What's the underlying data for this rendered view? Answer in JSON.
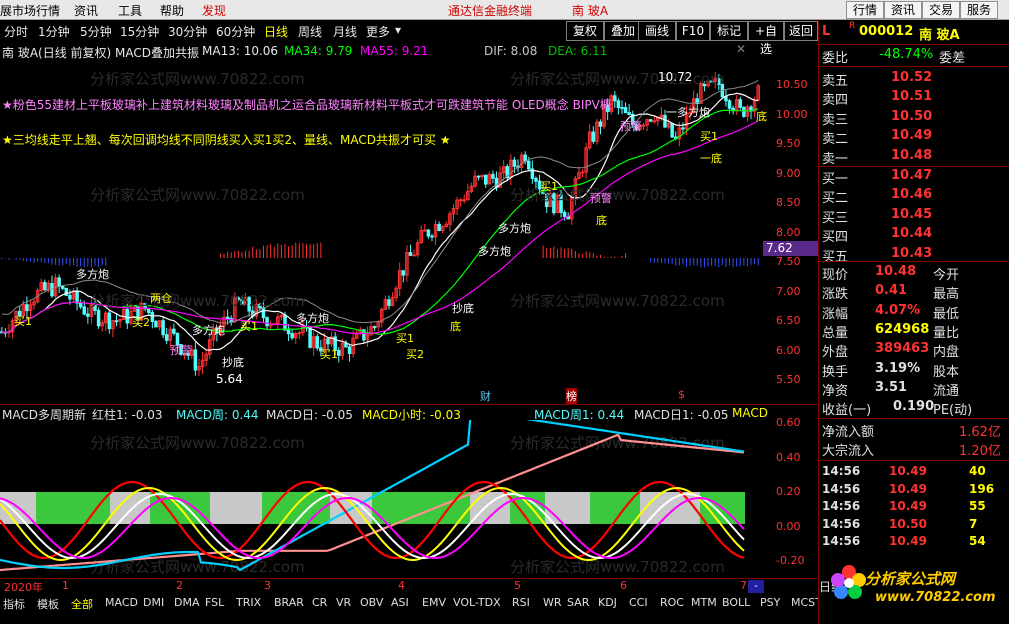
{
  "menubar": {
    "items": [
      "展市场行情",
      "资讯",
      "工具",
      "帮助",
      "发现"
    ],
    "app_title": "通达信金融终端",
    "stock_name": "南 玻A",
    "right_buttons": [
      "行情",
      "资讯",
      "交易",
      "服务"
    ]
  },
  "periodbar": {
    "periods": [
      "分时",
      "1分钟",
      "5分钟",
      "15分钟",
      "30分钟",
      "60分钟",
      "日线",
      "周线",
      "月线",
      "更多"
    ],
    "selected": "日线",
    "tools": [
      "复权",
      "叠加",
      "画线",
      "F10",
      "标记",
      "+自选",
      "返回"
    ]
  },
  "main_info": {
    "title": "南 玻A(日线 前复权) MACD叠加共振",
    "ma13": "MA13: 10.06",
    "ma34": "MA34: 9.79",
    "ma55": "MA55: 9.21",
    "dif": "DIF: 8.08",
    "dea": "DEA: 6.11"
  },
  "concepts": {
    "line1": "★粉色55建材上平板玻璃补上建筑材料玻璃及制品机之运合品玻璃新材料平板式才可跌建筑节能 OLED概念 BIPV概念",
    "line2": "★三均线走平上翘、每次回调均线不同阴线买入买1买2、量线、MACD共振才可买 ★"
  },
  "price_labels": {
    "high": "10.72",
    "low": "5.64",
    "current": "7.62",
    "axis": [
      "10.50",
      "10.00",
      "9.50",
      "9.00",
      "8.50",
      "8.00",
      "7.50",
      "7.00",
      "6.50",
      "6.00",
      "5.50"
    ]
  },
  "chart_annotations": [
    "多方炮",
    "多方炮",
    "买1",
    "买2",
    "两仓",
    "抄底",
    "买1",
    "多方炮",
    "多方炮",
    "买1",
    "买2",
    "抄底",
    "买1",
    "预警",
    "底",
    "买1",
    "预警",
    "底",
    "一多方炮",
    "预警",
    "多方炮",
    "买1",
    "一底",
    "底",
    "财",
    "榜",
    "$"
  ],
  "indicator": {
    "title": "MACD多周期新",
    "red_col": "红柱1: -0.03",
    "macd_week": "MACD周: 0.44",
    "macd_day": "MACD日: -0.05",
    "macd_hour": "MACD小时: -0.03",
    "macd_week1": "MACD周1: 0.44",
    "macd_day1": "MACD日1: -0.05",
    "macd_tail": "MACD",
    "axis": [
      "0.60",
      "0.40",
      "0.20",
      "0.00",
      "-0.20"
    ]
  },
  "timeaxis": [
    "2020年",
    "1",
    "2",
    "3",
    "4",
    "5",
    "6",
    "7"
  ],
  "tabs": [
    "指标",
    "模板",
    "全部",
    "MACD",
    "DMI",
    "DMA",
    "FSL",
    "TRIX",
    "BRAR",
    "CR",
    "VR",
    "OBV",
    "ASI",
    "EMV",
    "VOL-TDX",
    "RSI",
    "WR",
    "SAR",
    "KDJ",
    "CCI",
    "ROC",
    "MTM",
    "BOLL",
    "PSY",
    "MCST"
  ],
  "tab_selected": "全部",
  "quote": {
    "code": "000012",
    "name": "南 玻A",
    "weibi_label": "委比",
    "weibi": "-48.74%",
    "weicha_label": "委差",
    "sell": [
      {
        "label": "卖五",
        "price": "10.52"
      },
      {
        "label": "卖四",
        "price": "10.51"
      },
      {
        "label": "卖三",
        "price": "10.50"
      },
      {
        "label": "卖二",
        "price": "10.49"
      },
      {
        "label": "卖一",
        "price": "10.48"
      }
    ],
    "buy": [
      {
        "label": "买一",
        "price": "10.47"
      },
      {
        "label": "买二",
        "price": "10.46"
      },
      {
        "label": "买三",
        "price": "10.45"
      },
      {
        "label": "买四",
        "price": "10.44"
      },
      {
        "label": "买五",
        "price": "10.43"
      }
    ],
    "stats": [
      {
        "l1": "现价",
        "v1": "10.48",
        "l2": "今开"
      },
      {
        "l1": "涨跌",
        "v1": "0.41",
        "l2": "最高"
      },
      {
        "l1": "涨幅",
        "v1": "4.07%",
        "l2": "最低"
      },
      {
        "l1": "总量",
        "v1": "624968",
        "l2": "量比"
      },
      {
        "l1": "外盘",
        "v1": "389463",
        "l2": "内盘"
      },
      {
        "l1": "换手",
        "v1": "3.19%",
        "l2": "股本"
      },
      {
        "l1": "净资",
        "v1": "3.51",
        "l2": "流通"
      },
      {
        "l1": "收益(一)",
        "v1": "0.190",
        "l2": "PE(动)"
      }
    ],
    "netflow_label": "净流入额",
    "netflow": "1.62亿",
    "bigorder_label": "大宗流入",
    "bigorder": "1.20亿",
    "ticks": [
      {
        "t": "14:56",
        "p": "10.49",
        "v": "40"
      },
      {
        "t": "14:56",
        "p": "10.49",
        "v": "196"
      },
      {
        "t": "14:56",
        "p": "10.49",
        "v": "55"
      },
      {
        "t": "14:56",
        "p": "10.50",
        "v": "7"
      },
      {
        "t": "14:56",
        "p": "10.49",
        "v": "54"
      }
    ],
    "day_tab": "日线"
  },
  "watermark": "分析家公式网www.70822.com",
  "logo": {
    "cn": "分析家公式网",
    "url": "www.70822.com"
  },
  "colors": {
    "up": "#ff3232",
    "down": "#54fcfc",
    "ma13": "#ffffff",
    "ma34": "#00ff00",
    "ma55": "#ff00ff",
    "yellow": "#ffff00"
  }
}
